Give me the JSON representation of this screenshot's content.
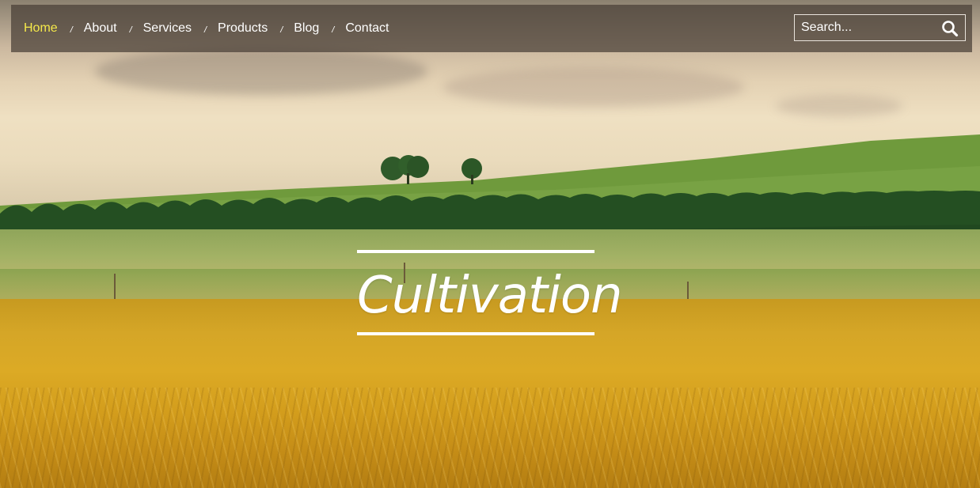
{
  "nav": {
    "items": [
      {
        "label": "Home",
        "active": true
      },
      {
        "label": "About",
        "active": false
      },
      {
        "label": "Services",
        "active": false
      },
      {
        "label": "Products",
        "active": false
      },
      {
        "label": "Blog",
        "active": false
      },
      {
        "label": "Contact",
        "active": false
      }
    ],
    "separator": "/",
    "active_color": "#f5e94a"
  },
  "search": {
    "placeholder": "Search...",
    "icon": "search-icon"
  },
  "hero": {
    "title": "Cultivation"
  }
}
